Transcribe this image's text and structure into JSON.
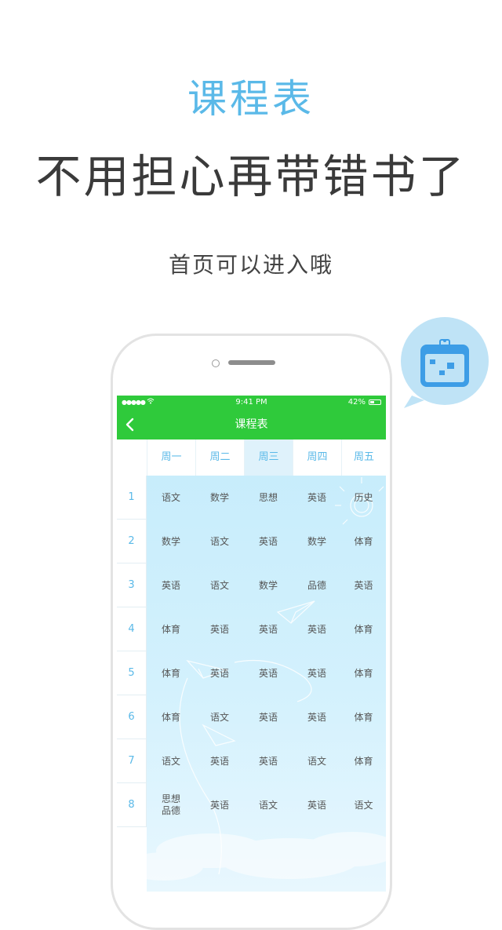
{
  "promo": {
    "title": "课程表",
    "headline": "不用担心再带错书了",
    "subtitle": "首页可以进入哦"
  },
  "status_bar": {
    "signal": "●●●●●",
    "time": "9:41 PM",
    "battery": "42%",
    "battery_level": 0.42
  },
  "nav": {
    "title": "课程表",
    "back_icon": "chevron-left-icon"
  },
  "timetable": {
    "days": [
      "周一",
      "周二",
      "周三",
      "周四",
      "周五"
    ],
    "active_day": "周三",
    "rows": [
      {
        "period": "1",
        "courses": [
          "语文",
          "数学",
          "思想",
          "英语",
          "历史"
        ]
      },
      {
        "period": "2",
        "courses": [
          "数学",
          "语文",
          "英语",
          "数学",
          "体育"
        ]
      },
      {
        "period": "3",
        "courses": [
          "英语",
          "语文",
          "数学",
          "品德",
          "英语"
        ]
      },
      {
        "period": "4",
        "courses": [
          "体育",
          "英语",
          "英语",
          "英语",
          "体育"
        ]
      },
      {
        "period": "5",
        "courses": [
          "体育",
          "英语",
          "英语",
          "英语",
          "体育"
        ]
      },
      {
        "period": "6",
        "courses": [
          "体育",
          "语文",
          "英语",
          "英语",
          "体育"
        ]
      },
      {
        "period": "7",
        "courses": [
          "语文",
          "英语",
          "英语",
          "语文",
          "体育"
        ]
      },
      {
        "period": "8",
        "courses": [
          "思想\n品德",
          "英语",
          "语文",
          "英语",
          "语文"
        ]
      }
    ]
  },
  "colors": {
    "accent": "#5ab9e8",
    "nav_green": "#2fca3b",
    "table_bg": "#c6ecfb"
  },
  "badge_icon": "calendar-icon"
}
